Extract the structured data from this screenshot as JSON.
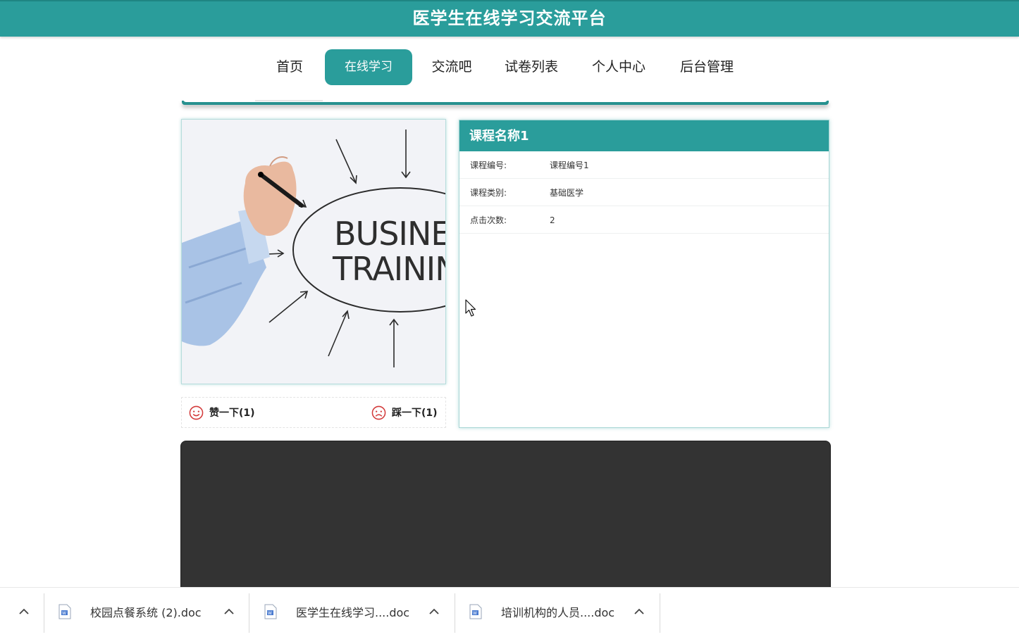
{
  "header": {
    "title": "医学生在线学习交流平台"
  },
  "nav": {
    "items": [
      {
        "label": "首页"
      },
      {
        "label": "在线学习"
      },
      {
        "label": "交流吧"
      },
      {
        "label": "试卷列表"
      },
      {
        "label": "个人中心"
      },
      {
        "label": "后台管理"
      }
    ],
    "active_index": 1
  },
  "course_image": {
    "icon": "business-training-image",
    "text_line1": "BUSINESS",
    "text_line2": "TRAINING"
  },
  "votes": {
    "like_label": "赞一下(1)",
    "dislike_label": "踩一下(1)"
  },
  "course": {
    "name": "课程名称1",
    "rows": [
      {
        "key": "课程编号:",
        "value": "课程编号1"
      },
      {
        "key": "课程类别:",
        "value": "基础医学"
      },
      {
        "key": "点击次数:",
        "value": "2"
      }
    ]
  },
  "downloads": {
    "items": [
      {
        "name": "校园点餐系统 (2).doc"
      },
      {
        "name": "医学生在线学习....doc"
      },
      {
        "name": "培训机构的人员....doc"
      }
    ]
  },
  "colors": {
    "accent": "#2a9d9b",
    "video_bg": "#333333",
    "vote_icon": "#d33a3a"
  }
}
